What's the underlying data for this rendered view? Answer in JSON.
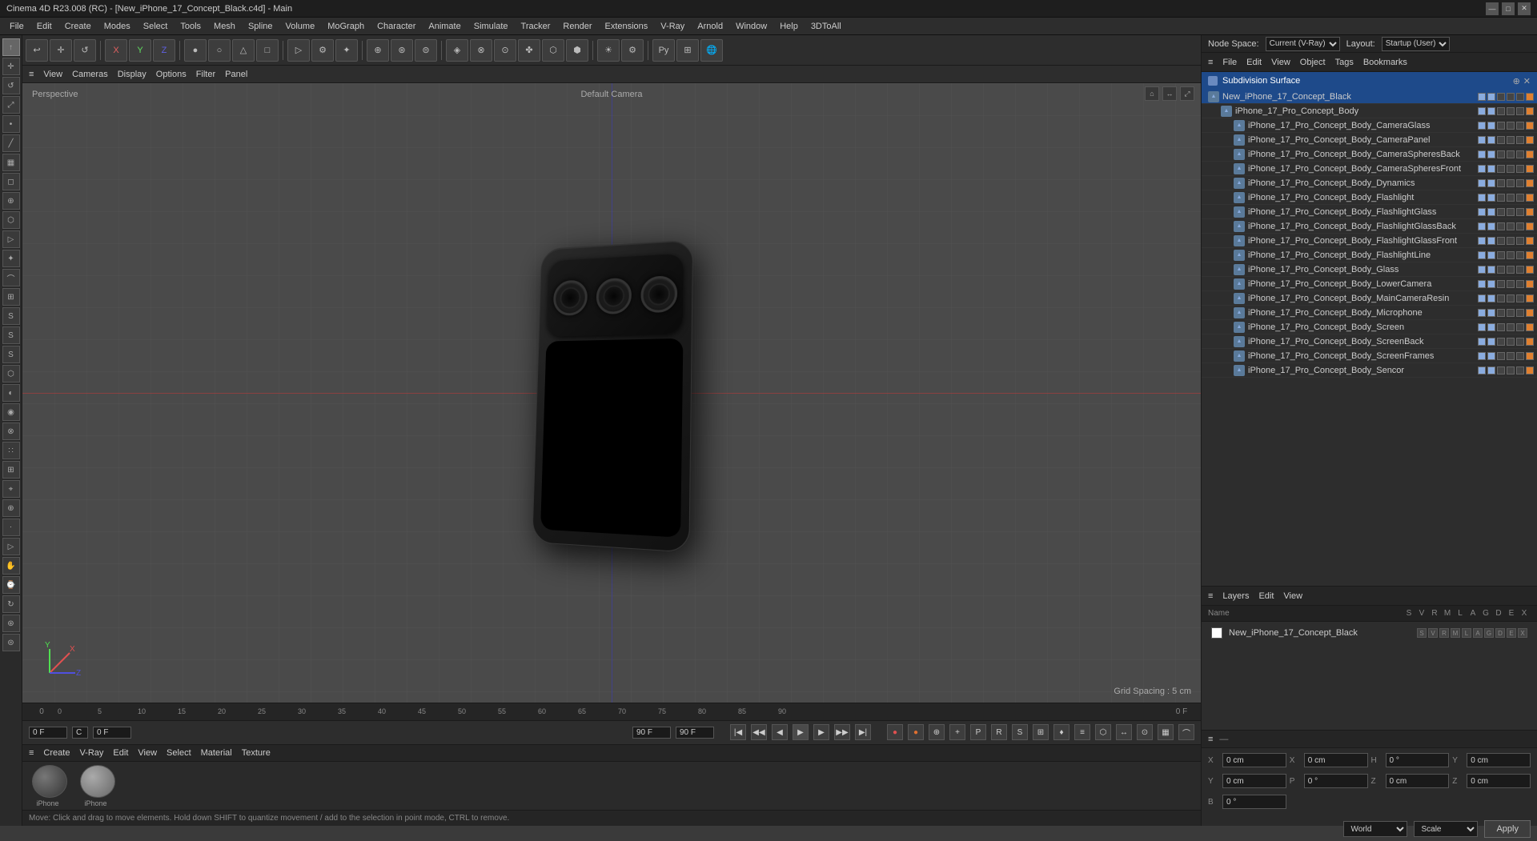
{
  "title_bar": {
    "title": "Cinema 4D R23.008 (RC) - [New_iPhone_17_Concept_Black.c4d] - Main",
    "min_label": "—",
    "max_label": "□",
    "close_label": "✕"
  },
  "menu_bar": {
    "items": [
      "File",
      "Edit",
      "Create",
      "Modes",
      "Select",
      "Tools",
      "Mesh",
      "Spline",
      "Volume",
      "MoGraph",
      "Character",
      "Animate",
      "Simulate",
      "Tracker",
      "Render",
      "Extensions",
      "V-Ray",
      "Arnold",
      "Window",
      "Help",
      "3DToAll"
    ]
  },
  "top_toolbar": {
    "buttons": [
      "⊞",
      "✛",
      "⟳",
      "X",
      "Y",
      "Z",
      "●",
      "○",
      "△",
      "□",
      "⬡",
      "▷",
      "⚙",
      "✦",
      "⊕",
      "⊛",
      "⊜",
      "◈",
      "⊗",
      "⊙",
      "✤",
      "⬡",
      "⬢",
      "☀",
      "⚙",
      "⬟",
      "▧",
      "⊕",
      "⋮",
      "⊞"
    ]
  },
  "viewport": {
    "perspective_label": "Perspective",
    "camera_label": "Default Camera",
    "grid_info": "Grid Spacing : 5 cm",
    "menus": [
      "View",
      "Cameras",
      "Display",
      "Options",
      "Filter",
      "Panel"
    ]
  },
  "object_manager": {
    "header_menus": [
      "File",
      "Edit",
      "View",
      "Object",
      "Tags",
      "Bookmarks"
    ],
    "node_space_label": "Node Space:",
    "node_space_value": "Current (V-Ray)",
    "layout_label": "Layout:",
    "layout_value": "Startup (User)",
    "title": "Subdivision Surface",
    "items": [
      {
        "name": "New_iPhone_17_Concept_Black",
        "level": 0,
        "type": "scene"
      },
      {
        "name": "iPhone_17_Pro_Concept_Body",
        "level": 1,
        "type": "obj"
      },
      {
        "name": "iPhone_17_Pro_Concept_Body_CameraGlass",
        "level": 2,
        "type": "tri"
      },
      {
        "name": "iPhone_17_Pro_Concept_Body_CameraPanel",
        "level": 2,
        "type": "tri"
      },
      {
        "name": "iPhone_17_Pro_Concept_Body_CameraSpheresBack",
        "level": 2,
        "type": "tri"
      },
      {
        "name": "iPhone_17_Pro_Concept_Body_CameraSpheresFront",
        "level": 2,
        "type": "tri"
      },
      {
        "name": "iPhone_17_Pro_Concept_Body_Dynamics",
        "level": 2,
        "type": "tri"
      },
      {
        "name": "iPhone_17_Pro_Concept_Body_Flashlight",
        "level": 2,
        "type": "tri"
      },
      {
        "name": "iPhone_17_Pro_Concept_Body_FlashlightGlass",
        "level": 2,
        "type": "tri"
      },
      {
        "name": "iPhone_17_Pro_Concept_Body_FlashlightGlassBack",
        "level": 2,
        "type": "tri"
      },
      {
        "name": "iPhone_17_Pro_Concept_Body_FlashlightGlassFront",
        "level": 2,
        "type": "tri"
      },
      {
        "name": "iPhone_17_Pro_Concept_Body_FlashlightLine",
        "level": 2,
        "type": "tri"
      },
      {
        "name": "iPhone_17_Pro_Concept_Body_Glass",
        "level": 2,
        "type": "tri"
      },
      {
        "name": "iPhone_17_Pro_Concept_Body_LowerCamera",
        "level": 2,
        "type": "tri"
      },
      {
        "name": "iPhone_17_Pro_Concept_Body_MainCameraResin",
        "level": 2,
        "type": "tri"
      },
      {
        "name": "iPhone_17_Pro_Concept_Body_Microphone",
        "level": 2,
        "type": "tri"
      },
      {
        "name": "iPhone_17_Pro_Concept_Body_Screen",
        "level": 2,
        "type": "tri"
      },
      {
        "name": "iPhone_17_Pro_Concept_Body_ScreenBack",
        "level": 2,
        "type": "tri"
      },
      {
        "name": "iPhone_17_Pro_Concept_Body_ScreenFrames",
        "level": 2,
        "type": "tri"
      },
      {
        "name": "iPhone_17_Pro_Concept_Body_Sencor",
        "level": 2,
        "type": "tri"
      }
    ]
  },
  "layer_manager": {
    "header_menus": [
      "Layers",
      "Edit",
      "View"
    ],
    "columns": {
      "name": "Name",
      "s": "S",
      "v": "V",
      "r": "R",
      "m": "M",
      "l": "L",
      "a": "A",
      "g": "G",
      "d": "D",
      "e": "E",
      "x": "X"
    },
    "items": [
      {
        "name": "New_iPhone_17_Concept_Black",
        "color": "#ffffff"
      }
    ]
  },
  "material_strip": {
    "menus": [
      "Create",
      "V-Ray",
      "Edit",
      "View",
      "Select",
      "Material",
      "Texture"
    ],
    "materials": [
      {
        "label": "iPhone_",
        "color": "#555555"
      },
      {
        "label": "iPhone_",
        "color": "#888888"
      }
    ]
  },
  "properties": {
    "x_pos_label": "X",
    "y_pos_label": "Y",
    "z_pos_label": "Z",
    "x_val": "0 cm",
    "y_val": "0 cm",
    "z_val": "0 cm",
    "x_rot_label": "X",
    "y_rot_label": "Y",
    "z_rot_label": "Z",
    "x_rot_val": "0 cm",
    "y_rot_val": "0 cm",
    "z_rot_val": "0 cm",
    "h_label": "H",
    "p_label": "P",
    "b_label": "B",
    "h_val": "0 °",
    "p_val": "0 °",
    "b_val": "0 °",
    "coord_system": "World",
    "transform_type": "Scale",
    "apply_label": "Apply"
  },
  "timeline": {
    "current_frame": "0 F",
    "end_frame": "90 F",
    "end_frame2": "90 F",
    "start_frame": "0 F",
    "fps_label": "C",
    "ticks": [
      "0",
      "5",
      "10",
      "15",
      "20",
      "25",
      "30",
      "35",
      "40",
      "45",
      "50",
      "55",
      "60",
      "65",
      "70",
      "75",
      "80",
      "85",
      "90"
    ]
  },
  "status_bar": {
    "text": "Move: Click and drag to move elements. Hold down SHIFT to quantize movement / add to the selection in point mode, CTRL to remove."
  }
}
